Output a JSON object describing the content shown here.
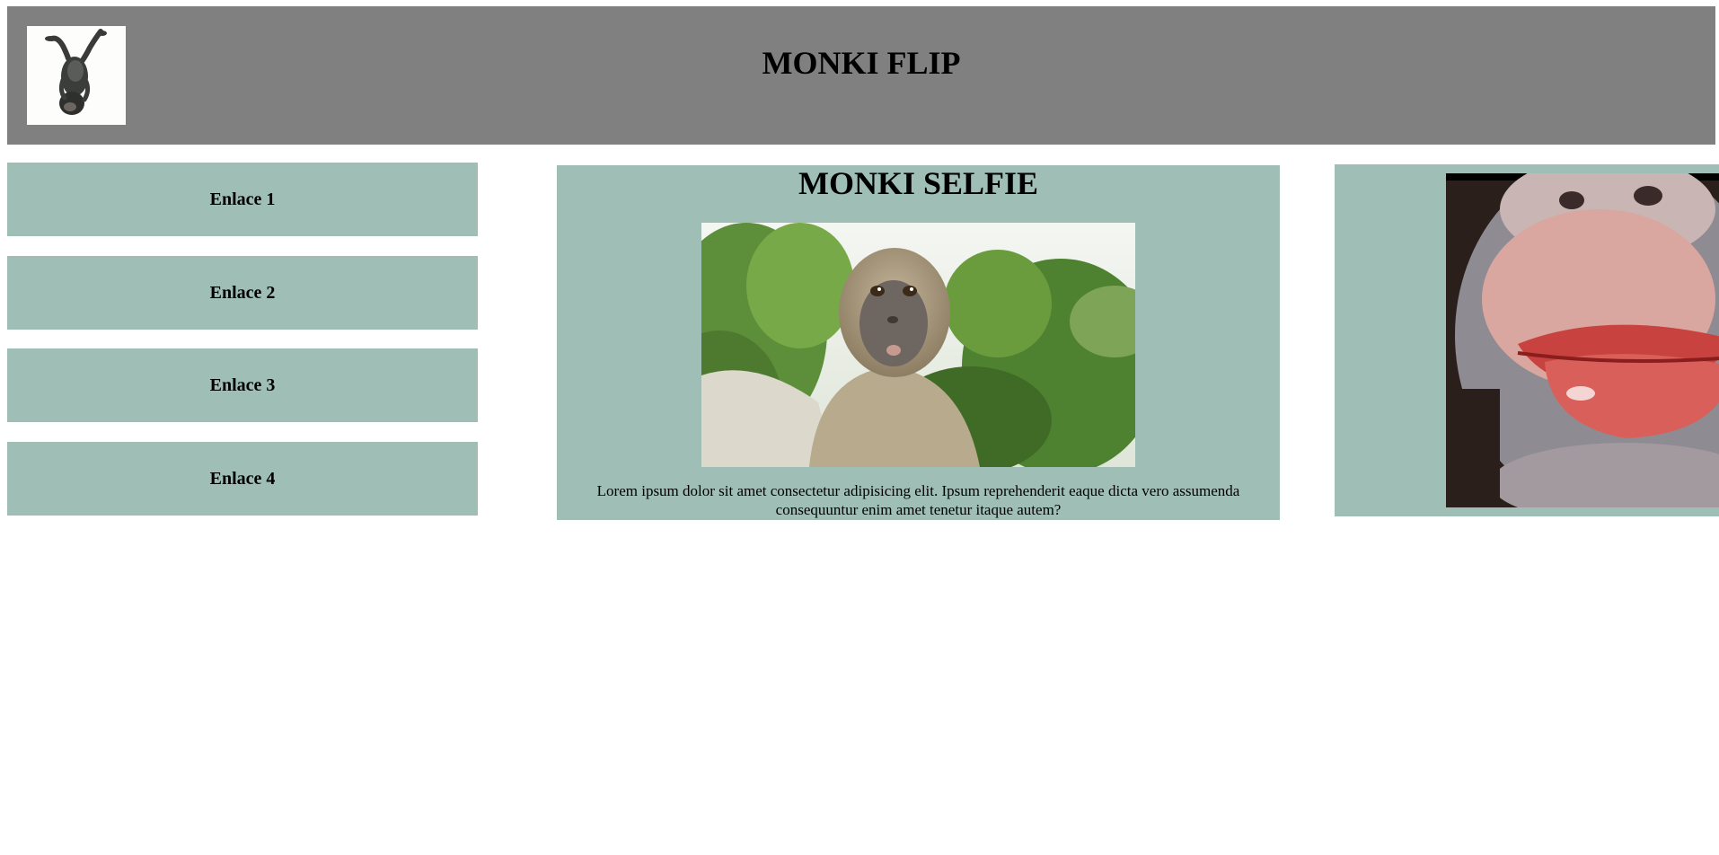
{
  "header": {
    "title": "MONKI FLIP",
    "logo_icon": "upside-down-monkey-icon"
  },
  "nav": {
    "items": [
      {
        "label": "Enlace 1"
      },
      {
        "label": "Enlace 2"
      },
      {
        "label": "Enlace 3"
      },
      {
        "label": "Enlace 4"
      }
    ]
  },
  "main": {
    "title": "MONKI SELFIE",
    "image": "monkey-selfie-photo",
    "text": "Lorem ipsum dolor sit amet consectetur adipisicing elit. Ipsum reprehenderit eaque dicta vero assumenda consequuntur enim amet tenetur itaque autem?"
  },
  "aside": {
    "image": "monkey-lips-photo"
  },
  "colors": {
    "header_bg": "#808080",
    "panel_bg": "#9ebeb6",
    "page_bg": "#ffffff"
  }
}
